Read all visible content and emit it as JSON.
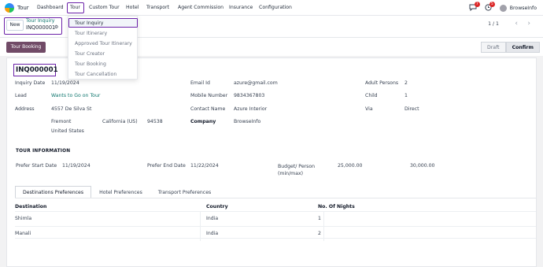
{
  "nav": {
    "app_name": "Tour",
    "menu": [
      "Dashboard",
      "Tour",
      "Custom Tour",
      "Hotel",
      "Transport",
      "Agent Commission",
      "Insurance",
      "Configuration"
    ],
    "chat_badge": "7",
    "activity_badge": "5",
    "company": "BrowseInfo"
  },
  "control": {
    "new_label": "New",
    "breadcrumb_parent": "Tour Inquiry",
    "breadcrumb_current": "INQ000001",
    "pager": "1 / 1"
  },
  "dropdown": {
    "items": [
      "Tour Inquiry",
      "Tour Itinerary",
      "Approved Tour Itinerary",
      "Tour Creator",
      "Tour Booking",
      "Tour Cancellation"
    ]
  },
  "actions": {
    "tour_booking": "Tour Booking",
    "status": [
      "Draft",
      "Confirm"
    ]
  },
  "form": {
    "record": "INQ000001",
    "inquiry_date_label": "Inquiry Date",
    "inquiry_date": "11/19/2024",
    "lead_label": "Lead",
    "lead": "Wants to Go on Tour",
    "address_label": "Address",
    "street": "4557 De Silva St",
    "city": "Fremont",
    "state": "California (US)",
    "zip": "94538",
    "country": "United States",
    "email_label": "Email Id",
    "email": "azure@gmail.com",
    "mobile_label": "Mobile Number",
    "mobile": "9834367803",
    "contact_label": "Contact Name",
    "contact": "Azure Interior",
    "company_label": "Company",
    "company": "BrowseInfo",
    "adult_label": "Adult Persons",
    "adult": "2",
    "child_label": "Child",
    "child": "1",
    "via_label": "Via",
    "via": "Direct"
  },
  "tour_info": {
    "heading": "TOUR INFORMATION",
    "start_label": "Prefer Start Date",
    "start": "11/19/2024",
    "end_label": "Prefer End Date",
    "end": "11/22/2024",
    "budget_label": "Budget/ Person (min/max)",
    "budget_min": "25,000.00",
    "budget_max": "30,000.00"
  },
  "tabs": [
    "Destinations Preferences",
    "Hotel Preferences",
    "Transport Preferences"
  ],
  "table": {
    "columns": [
      "Destination",
      "Country",
      "No. Of Nights"
    ],
    "rows": [
      {
        "destination": "Shimla",
        "country": "India",
        "nights": "1"
      },
      {
        "destination": "Manali",
        "country": "India",
        "nights": "2"
      }
    ]
  }
}
